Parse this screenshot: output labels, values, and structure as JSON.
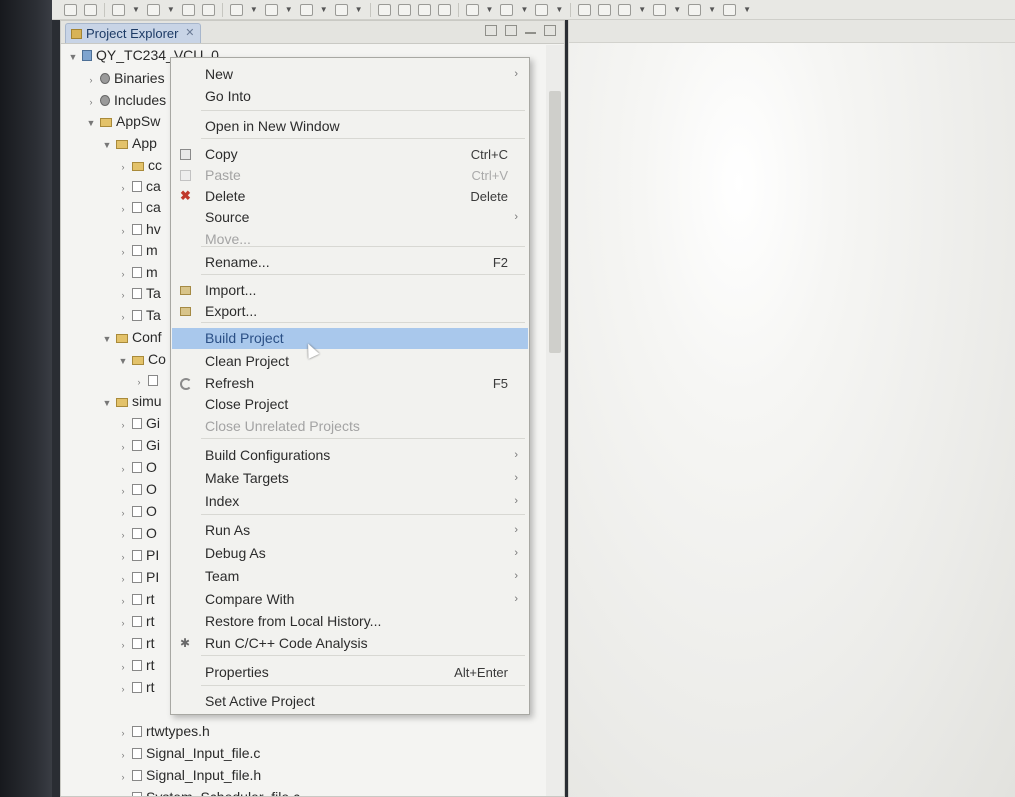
{
  "explorer": {
    "tab_label": "Project Explorer",
    "tree": [
      {
        "label": "QY_TC234_VCU_0",
        "twisty": "expanded",
        "icon": "project-icon"
      },
      {
        "label": "Binaries",
        "twisty": "collapsed",
        "icon": "binary-icon"
      },
      {
        "label": "Includes",
        "twisty": "collapsed",
        "icon": "include-icon"
      },
      {
        "label": "AppSw",
        "twisty": "expanded",
        "icon": "folder-icon"
      },
      {
        "label": "App",
        "twisty": "expanded",
        "icon": "folder-icon"
      },
      {
        "label": "cc",
        "twisty": "collapsed",
        "icon": "folder-icon"
      },
      {
        "label": "ca",
        "twisty": "collapsed",
        "icon": "file-icon"
      },
      {
        "label": "ca",
        "twisty": "collapsed",
        "icon": "file-icon"
      },
      {
        "label": "hv",
        "twisty": "collapsed",
        "icon": "file-icon"
      },
      {
        "label": "m",
        "twisty": "collapsed",
        "icon": "file-icon"
      },
      {
        "label": "m",
        "twisty": "collapsed",
        "icon": "file-icon"
      },
      {
        "label": "Ta",
        "twisty": "collapsed",
        "icon": "file-icon"
      },
      {
        "label": "Ta",
        "twisty": "collapsed",
        "icon": "file-icon"
      },
      {
        "label": "Conf",
        "twisty": "expanded",
        "icon": "folder-icon"
      },
      {
        "label": "Co",
        "twisty": "expanded",
        "icon": "folder-icon"
      },
      {
        "label": "",
        "twisty": "collapsed",
        "icon": "file-icon"
      },
      {
        "label": "simu",
        "twisty": "expanded",
        "icon": "folder-icon"
      },
      {
        "label": "Gi",
        "twisty": "collapsed",
        "icon": "file-icon"
      },
      {
        "label": "Gi",
        "twisty": "collapsed",
        "icon": "file-icon"
      },
      {
        "label": "O",
        "twisty": "collapsed",
        "icon": "file-icon"
      },
      {
        "label": "O",
        "twisty": "collapsed",
        "icon": "file-icon"
      },
      {
        "label": "O",
        "twisty": "collapsed",
        "icon": "file-icon"
      },
      {
        "label": "O",
        "twisty": "collapsed",
        "icon": "file-icon"
      },
      {
        "label": "PI",
        "twisty": "collapsed",
        "icon": "file-icon"
      },
      {
        "label": "PI",
        "twisty": "collapsed",
        "icon": "file-icon"
      },
      {
        "label": "rt",
        "twisty": "collapsed",
        "icon": "file-icon"
      },
      {
        "label": "rt",
        "twisty": "collapsed",
        "icon": "file-icon"
      },
      {
        "label": "rt",
        "twisty": "collapsed",
        "icon": "file-icon"
      },
      {
        "label": "rt",
        "twisty": "collapsed",
        "icon": "file-icon"
      },
      {
        "label": "rt",
        "twisty": "collapsed",
        "icon": "file-icon"
      },
      {
        "label": "rtwtypes.h",
        "twisty": "collapsed",
        "icon": "file-icon"
      },
      {
        "label": "Signal_Input_file.c",
        "twisty": "collapsed",
        "icon": "file-icon"
      },
      {
        "label": "Signal_Input_file.h",
        "twisty": "collapsed",
        "icon": "file-icon"
      },
      {
        "label": "System_Scheduler_file.c",
        "twisty": "collapsed",
        "icon": "file-icon"
      }
    ]
  },
  "context_menu": {
    "items": [
      {
        "label": "New",
        "accel": "",
        "submenu": true,
        "enabled": true,
        "icon": ""
      },
      {
        "label": "Go Into",
        "accel": "",
        "submenu": false,
        "enabled": true,
        "icon": ""
      },
      {
        "label": "Open in New Window",
        "accel": "",
        "submenu": false,
        "enabled": true,
        "icon": ""
      },
      {
        "label": "Copy",
        "accel": "Ctrl+C",
        "submenu": false,
        "enabled": true,
        "icon": "copy-icon"
      },
      {
        "label": "Paste",
        "accel": "Ctrl+V",
        "submenu": false,
        "enabled": false,
        "icon": "paste-icon"
      },
      {
        "label": "Delete",
        "accel": "Delete",
        "submenu": false,
        "enabled": true,
        "icon": "delete-icon"
      },
      {
        "label": "Source",
        "accel": "",
        "submenu": true,
        "enabled": true,
        "icon": ""
      },
      {
        "label": "Move...",
        "accel": "",
        "submenu": false,
        "enabled": false,
        "icon": ""
      },
      {
        "label": "Rename...",
        "accel": "F2",
        "submenu": false,
        "enabled": true,
        "icon": ""
      },
      {
        "label": "Import...",
        "accel": "",
        "submenu": false,
        "enabled": true,
        "icon": "import-icon"
      },
      {
        "label": "Export...",
        "accel": "",
        "submenu": false,
        "enabled": true,
        "icon": "export-icon"
      },
      {
        "label": "Build Project",
        "accel": "",
        "submenu": false,
        "enabled": true,
        "icon": "",
        "highlighted": true
      },
      {
        "label": "Clean Project",
        "accel": "",
        "submenu": false,
        "enabled": true,
        "icon": ""
      },
      {
        "label": "Refresh",
        "accel": "F5",
        "submenu": false,
        "enabled": true,
        "icon": "refresh-icon"
      },
      {
        "label": "Close Project",
        "accel": "",
        "submenu": false,
        "enabled": true,
        "icon": ""
      },
      {
        "label": "Close Unrelated Projects",
        "accel": "",
        "submenu": false,
        "enabled": false,
        "icon": ""
      },
      {
        "label": "Build Configurations",
        "accel": "",
        "submenu": true,
        "enabled": true,
        "icon": ""
      },
      {
        "label": "Make Targets",
        "accel": "",
        "submenu": true,
        "enabled": true,
        "icon": ""
      },
      {
        "label": "Index",
        "accel": "",
        "submenu": true,
        "enabled": true,
        "icon": ""
      },
      {
        "label": "Run As",
        "accel": "",
        "submenu": true,
        "enabled": true,
        "icon": ""
      },
      {
        "label": "Debug As",
        "accel": "",
        "submenu": true,
        "enabled": true,
        "icon": ""
      },
      {
        "label": "Team",
        "accel": "",
        "submenu": true,
        "enabled": true,
        "icon": ""
      },
      {
        "label": "Compare With",
        "accel": "",
        "submenu": true,
        "enabled": true,
        "icon": ""
      },
      {
        "label": "Restore from Local History...",
        "accel": "",
        "submenu": false,
        "enabled": true,
        "icon": ""
      },
      {
        "label": "Run C/C++ Code Analysis",
        "accel": "",
        "submenu": false,
        "enabled": true,
        "icon": "code-analysis-icon"
      },
      {
        "label": "Properties",
        "accel": "Alt+Enter",
        "submenu": false,
        "enabled": true,
        "icon": ""
      },
      {
        "label": "Set Active Project",
        "accel": "",
        "submenu": false,
        "enabled": true,
        "icon": ""
      }
    ]
  },
  "colors": {
    "menu_highlight": "#a9c8ec",
    "menu_background": "#f2f2ef",
    "disabled_text": "#a3a3a3"
  }
}
